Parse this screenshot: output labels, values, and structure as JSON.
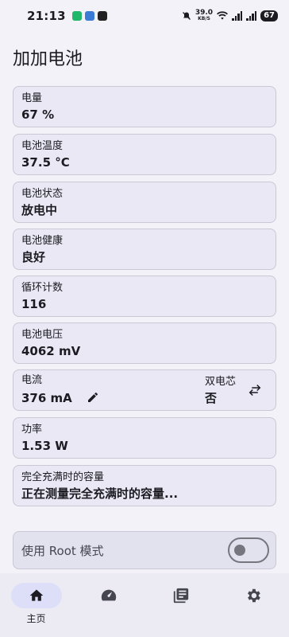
{
  "status_bar": {
    "time": "21:13",
    "net_speed_value": "39.0",
    "net_speed_unit": "KB/S",
    "battery": "67"
  },
  "title": "加加电池",
  "cards": {
    "level": {
      "label": "电量",
      "value": "67 %"
    },
    "temperature": {
      "label": "电池温度",
      "value": "37.5 °C"
    },
    "state": {
      "label": "电池状态",
      "value": "放电中"
    },
    "health": {
      "label": "电池健康",
      "value": "良好"
    },
    "cycles": {
      "label": "循环计数",
      "value": "116"
    },
    "voltage": {
      "label": "电池电压",
      "value": "4062 mV"
    },
    "current": {
      "label": "电流",
      "value": "376 mA"
    },
    "dual_cell": {
      "label": "双电芯",
      "value": "否"
    },
    "power": {
      "label": "功率",
      "value": "1.53 W"
    },
    "full_capacity": {
      "label": "完全充满时的容量",
      "value": "正在测量完全充满时的容量..."
    }
  },
  "root_mode": {
    "label": "使用 Root 模式",
    "enabled": false
  },
  "nav": {
    "items": [
      {
        "label": "主页",
        "icon": "home-icon",
        "active": true
      },
      {
        "label": "",
        "icon": "speedometer-icon",
        "active": false
      },
      {
        "label": "",
        "icon": "library-icon",
        "active": false
      },
      {
        "label": "",
        "icon": "gear-icon",
        "active": false
      }
    ]
  },
  "colors": {
    "background": "#f3f2f9",
    "card": "#e9e8f4",
    "card_border": "#c9c8d4",
    "nav_active": "#dcdff7"
  }
}
